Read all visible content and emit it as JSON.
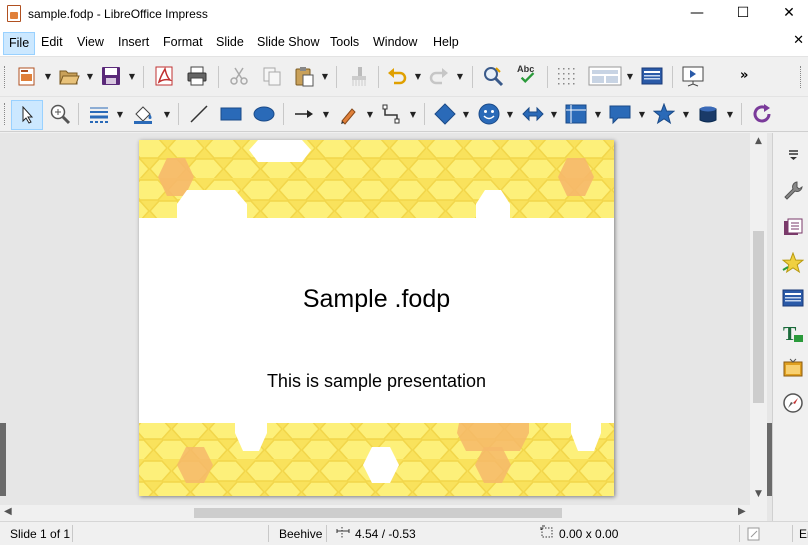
{
  "window": {
    "title": "sample.fodp - LibreOffice Impress",
    "minimize": "—",
    "maximize": "☐",
    "close": "✕"
  },
  "menubar": {
    "items": [
      "File",
      "Edit",
      "View",
      "Insert",
      "Format",
      "Slide",
      "Slide Show",
      "Tools",
      "Window",
      "Help"
    ],
    "active": "File",
    "close_doc": "✕"
  },
  "toolbar_standard": {
    "icons": [
      "new-icon",
      "open-icon",
      "save-icon",
      "export-pdf-icon",
      "print-icon",
      "cut-icon",
      "copy-icon",
      "paste-icon",
      "clone-formatting-icon",
      "undo-icon",
      "redo-icon",
      "find-replace-icon",
      "spelling-icon",
      "grid-icon",
      "slide-layout-icon",
      "master-slides-icon",
      "start-slideshow-icon"
    ],
    "overflow": "»"
  },
  "toolbar_drawing": {
    "icons": [
      "select-icon",
      "zoom-pan-icon",
      "line-style-icon",
      "fill-color-icon",
      "line-icon",
      "rectangle-icon",
      "ellipse-icon",
      "arrow-line-icon",
      "curve-icon",
      "connector-icon",
      "basic-shapes-icon",
      "symbol-shapes-icon",
      "block-arrows-icon",
      "flowchart-icon",
      "callouts-icon",
      "stars-icon",
      "3d-objects-icon",
      "rotate-icon"
    ]
  },
  "slide": {
    "title": "Sample .fodp",
    "subtitle": "This is sample presentation"
  },
  "sidebar": {
    "icons": [
      "sidebar-menu-icon",
      "properties-icon",
      "slide-transition-icon",
      "animation-icon",
      "master-slides-panel-icon",
      "styles-icon",
      "gallery-icon",
      "navigator-icon"
    ]
  },
  "statusbar": {
    "slide": "Slide 1 of 1",
    "master": "Beehive",
    "position": "4.54 / -0.53",
    "size": "0.00 x 0.00",
    "language": "En"
  },
  "colors": {
    "honey_light": "#fdf07a",
    "honey_mid": "#f9e25c",
    "honey_orange": "#f6b86a",
    "selection": "#cce8ff"
  }
}
